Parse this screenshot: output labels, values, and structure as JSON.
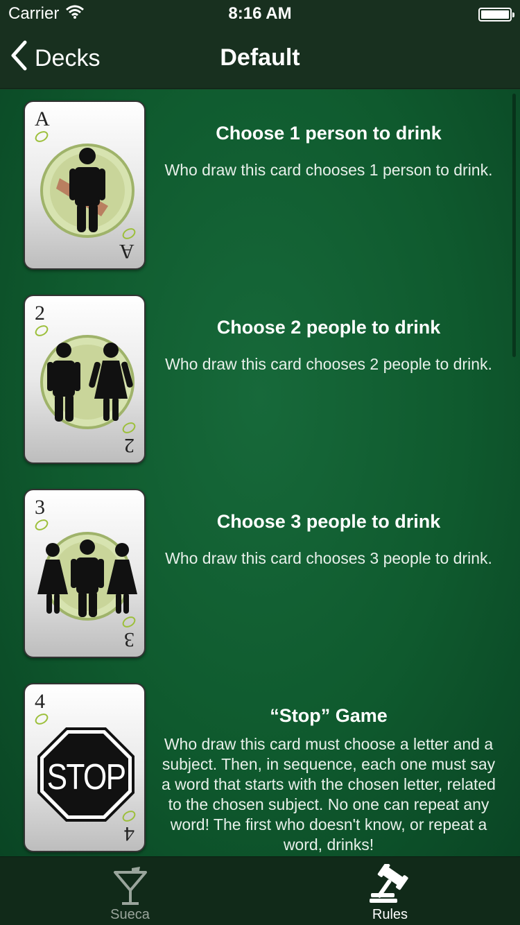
{
  "status_bar": {
    "carrier": "Carrier",
    "time": "8:16 AM",
    "battery_level": 1.0
  },
  "nav": {
    "back_label": "Decks",
    "title": "Default"
  },
  "rules": [
    {
      "rank": "A",
      "title": "Choose 1 person to drink",
      "description": "Who draw this card chooses 1 person to drink."
    },
    {
      "rank": "2",
      "title": "Choose 2 people to drink",
      "description": "Who draw this card chooses 2 people to drink."
    },
    {
      "rank": "3",
      "title": "Choose 3 people to drink",
      "description": "Who draw this card chooses 3 people to drink."
    },
    {
      "rank": "4",
      "title": "“Stop” Game",
      "description": "Who draw this card must choose a letter and a subject. Then, in sequence, each one must say a word that starts with the chosen letter, related to the chosen subject. No one can repeat any word! The first who doesn't know, or repeat a word, drinks!",
      "sign_text": "STOP"
    }
  ],
  "tabs": [
    {
      "label": "Sueca",
      "selected": false,
      "icon": "cocktail-glass-icon"
    },
    {
      "label": "Rules",
      "selected": true,
      "icon": "gavel-icon"
    }
  ],
  "colors": {
    "background_green": "#0f5a2e",
    "bar_dark": "#18301f",
    "tab_selected": "#ffffff",
    "tab_unselected": "#9aa59c"
  }
}
